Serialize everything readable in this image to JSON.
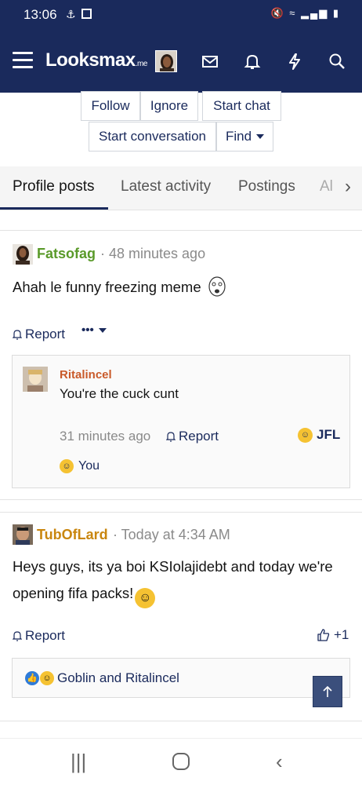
{
  "status_bar": {
    "time": "13:06"
  },
  "nav": {
    "logo_text": "Looksmax",
    "logo_suffix": ".me"
  },
  "member_actions": {
    "follow": "Follow",
    "ignore": "Ignore",
    "start_chat": "Start chat",
    "start_conversation": "Start conversation",
    "find": "Find"
  },
  "tabs": [
    "Profile posts",
    "Latest activity",
    "Postings",
    "Al"
  ],
  "posts": [
    {
      "author": "Fatsofag",
      "author_color": "#5a9a2a",
      "time": "· 48 minutes ago",
      "text": "Ahah le funny freezing meme",
      "report": "Report",
      "comment": {
        "author": "Ritalincel",
        "text": "You're the cuck cunt",
        "time": "31 minutes ago",
        "report": "Report",
        "reaction_label": "JFL",
        "reaction_by": "You"
      }
    },
    {
      "author": "TubOfLard",
      "author_color": "#c9860e",
      "time": "· Today at 4:34 AM",
      "text_line1": "Heys guys, its ya boi KSIolajidebt and today we're",
      "text_line2": "opening fifa packs!",
      "report": "Report",
      "like_count": "+1",
      "reactions_by": "Goblin and Ritalincel"
    }
  ]
}
